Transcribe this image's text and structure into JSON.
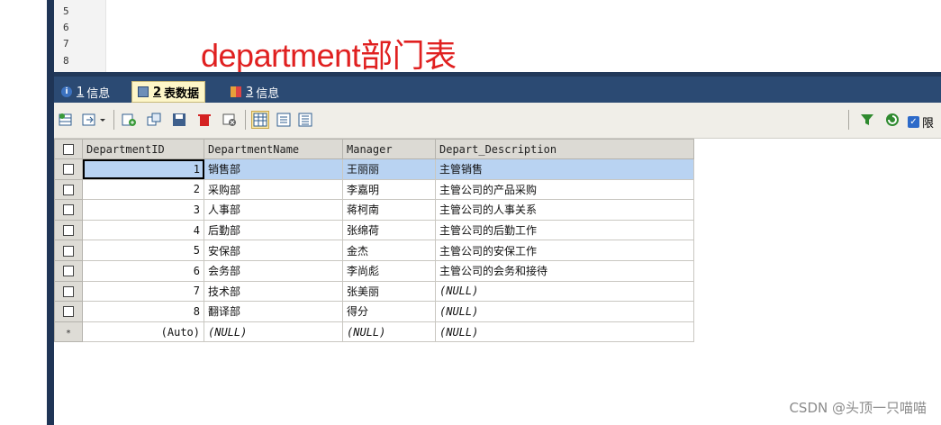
{
  "editor": {
    "line_numbers": [
      "5",
      "6",
      "7",
      "8"
    ],
    "heading": "department部门表"
  },
  "tabs": [
    {
      "num": "1",
      "label": "信息",
      "icon": "info-icon"
    },
    {
      "num": "2",
      "label": "表数据",
      "icon": "table-icon"
    },
    {
      "num": "3",
      "label": "信息",
      "icon": "message-icon"
    }
  ],
  "toolbar": {
    "limit_label": "限"
  },
  "table": {
    "columns": [
      "DepartmentID",
      "DepartmentName",
      "Manager",
      "Depart_Description"
    ],
    "rows": [
      [
        "1",
        "销售部",
        "王丽丽",
        "主管销售"
      ],
      [
        "2",
        "采购部",
        "李嘉明",
        "主管公司的产品采购"
      ],
      [
        "3",
        "人事部",
        "蒋柯南",
        "主管公司的人事关系"
      ],
      [
        "4",
        "后勤部",
        "张绵荷",
        "主管公司的后勤工作"
      ],
      [
        "5",
        "安保部",
        "金杰",
        "主管公司的安保工作"
      ],
      [
        "6",
        "会务部",
        "李尚彪",
        "主管公司的会务和接待"
      ],
      [
        "7",
        "技术部",
        "张美丽",
        "(NULL)"
      ],
      [
        "8",
        "翻译部",
        "得分",
        "(NULL)"
      ]
    ],
    "new_row": [
      "(Auto)",
      "(NULL)",
      "(NULL)",
      "(NULL)"
    ],
    "new_row_marker": "*"
  },
  "watermark": "CSDN @头顶一只喵喵",
  "colors": {
    "heading": "#e02020",
    "tabbar": "#2b4a73",
    "selected_row": "#b9d3f2"
  }
}
